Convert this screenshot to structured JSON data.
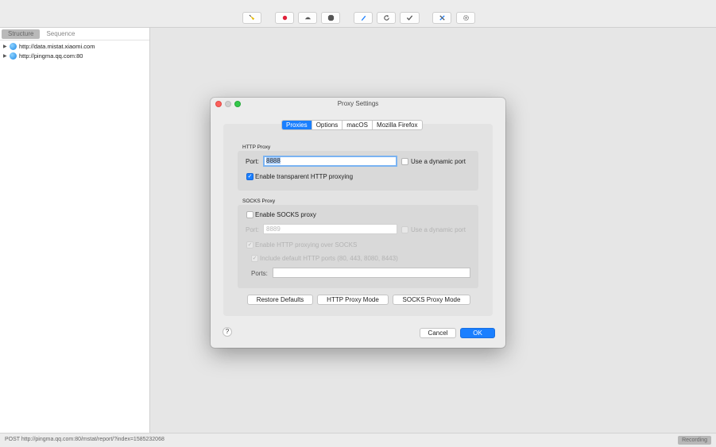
{
  "toolbar": {
    "buttons": [
      {
        "icon": "broom-icon"
      },
      {
        "icon": "record-icon"
      },
      {
        "icon": "turtle-icon"
      },
      {
        "icon": "stop-icon"
      },
      {
        "icon": "pen-icon"
      },
      {
        "icon": "refresh-icon"
      },
      {
        "icon": "check-icon"
      },
      {
        "icon": "tools-icon"
      },
      {
        "icon": "gear-icon"
      }
    ]
  },
  "sidebar": {
    "tabs": [
      "Structure",
      "Sequence"
    ],
    "active_tab": "Structure",
    "hosts": [
      "http://data.mistat.xiaomi.com",
      "http://pingma.qq.com:80"
    ]
  },
  "dialog": {
    "title": "Proxy Settings",
    "tabs": [
      "Proxies",
      "Options",
      "macOS",
      "Mozilla Firefox"
    ],
    "active_tab": "Proxies",
    "http": {
      "section": "HTTP Proxy",
      "port_label": "Port:",
      "port_value": "8888",
      "dynamic_label": "Use a dynamic port",
      "transparent_label": "Enable transparent HTTP proxying"
    },
    "socks": {
      "section": "SOCKS Proxy",
      "enable_label": "Enable SOCKS proxy",
      "port_label": "Port:",
      "port_value": "8889",
      "dynamic_label": "Use a dynamic port",
      "http_over_socks_label": "Enable HTTP proxying over SOCKS",
      "default_ports_label": "Include default HTTP ports (80, 443, 8080, 8443)",
      "ports_label": "Ports:",
      "ports_value": ""
    },
    "buttons": {
      "restore": "Restore Defaults",
      "http_mode": "HTTP Proxy Mode",
      "socks_mode": "SOCKS Proxy Mode",
      "cancel": "Cancel",
      "ok": "OK",
      "help": "?"
    }
  },
  "status": {
    "text": "POST http://pingma.qq.com:80/mstat/report/?index=1585232068",
    "recording": "Recording"
  },
  "colors": {
    "accent": "#1a7fff",
    "close": "#fc605c",
    "zoom": "#34c84a"
  }
}
